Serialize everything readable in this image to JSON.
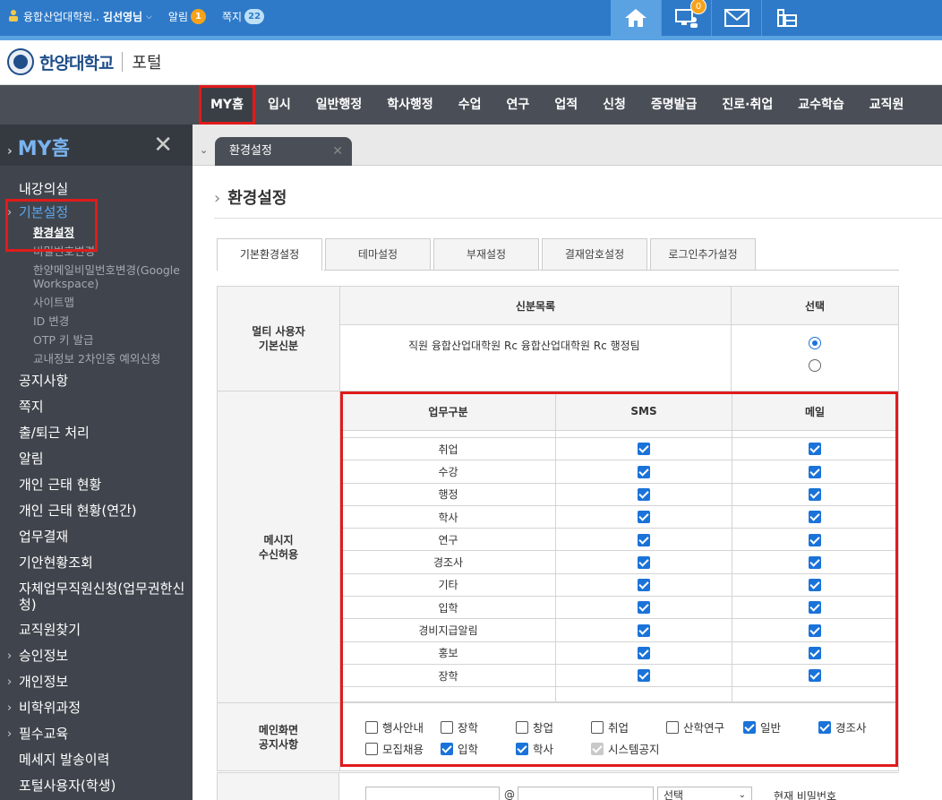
{
  "topbar": {
    "user_org": "융합산업대학원..",
    "user_name": "김선영님",
    "alarm_label": "알림",
    "alarm_count": "1",
    "note_label": "쪽지",
    "note_count": "22",
    "monitor_badge": "0"
  },
  "logo": {
    "univ": "한양대학교",
    "portal": "포털"
  },
  "gnb": [
    "MY홈",
    "입시",
    "일반행정",
    "학사행정",
    "수업",
    "연구",
    "업적",
    "신청",
    "증명발급",
    "진로·취업",
    "교수학습",
    "교직원"
  ],
  "sidebar": {
    "title": "MY홈",
    "close": "✕",
    "items": [
      {
        "label": "내강의실"
      },
      {
        "label": "기본설정"
      },
      {
        "label": "환경설정"
      },
      {
        "label": "비밀번호변경"
      },
      {
        "label": "한양메일비밀번호변경(Google Workspace)"
      },
      {
        "label": "사이트맵"
      },
      {
        "label": "ID 변경"
      },
      {
        "label": "OTP 키 발급"
      },
      {
        "label": "교내정보 2차인증 예외신청"
      },
      {
        "label": "공지사항"
      },
      {
        "label": "쪽지"
      },
      {
        "label": "출/퇴근 처리"
      },
      {
        "label": "알림"
      },
      {
        "label": "개인 근태 현황"
      },
      {
        "label": "개인 근태 현황(연간)"
      },
      {
        "label": "업무결재"
      },
      {
        "label": "기안현황조회"
      },
      {
        "label": "자체업무직원신청(업무권한신청)"
      },
      {
        "label": "교직원찾기"
      },
      {
        "label": "승인정보"
      },
      {
        "label": "개인정보"
      },
      {
        "label": "비학위과정"
      },
      {
        "label": "필수교육"
      },
      {
        "label": "메세지 발송이력"
      },
      {
        "label": "포털사용자(학생)"
      }
    ]
  },
  "content": {
    "tab_label": "환경설정",
    "page_title": "환경설정",
    "subtabs": [
      "기본환경설정",
      "테마설정",
      "부재설정",
      "결재암호설정",
      "로그인추가설정"
    ],
    "multi": {
      "label_line1": "멀티 사용자",
      "label_line2": "기본신분",
      "col_list": "신분목록",
      "col_select": "선택",
      "row_text": "직원 융합산업대학원 Rc 융합산업대학원 Rc 행정팀"
    },
    "message": {
      "label_line1": "메시지",
      "label_line2": "수신허용",
      "col_type": "업무구분",
      "col_sms": "SMS",
      "col_mail": "메일",
      "rows": [
        "취업",
        "수강",
        "행정",
        "학사",
        "연구",
        "경조사",
        "기타",
        "입학",
        "경비지급알림",
        "홍보",
        "장학"
      ]
    },
    "notice": {
      "label_line1": "메인화면",
      "label_line2": "공지사항",
      "row1": [
        {
          "label": "행사안내",
          "checked": false
        },
        {
          "label": "장학",
          "checked": false
        },
        {
          "label": "창업",
          "checked": false
        },
        {
          "label": "취업",
          "checked": false
        },
        {
          "label": "산학연구",
          "checked": false
        },
        {
          "label": "일반",
          "checked": true
        },
        {
          "label": "경조사",
          "checked": true
        }
      ],
      "row2": [
        {
          "label": "모집채용",
          "checked": false
        },
        {
          "label": "입학",
          "checked": true
        },
        {
          "label": "학사",
          "checked": true
        },
        {
          "label": "시스템공지",
          "checked": true,
          "disabled": true
        }
      ]
    },
    "email": {
      "at": "@",
      "select": "선택",
      "current_pw": "현재 비밀번호"
    }
  },
  "colors": {
    "accent": "#1a73d9",
    "highlight": "#e01b1b",
    "topbar": "#2e7ac8"
  }
}
